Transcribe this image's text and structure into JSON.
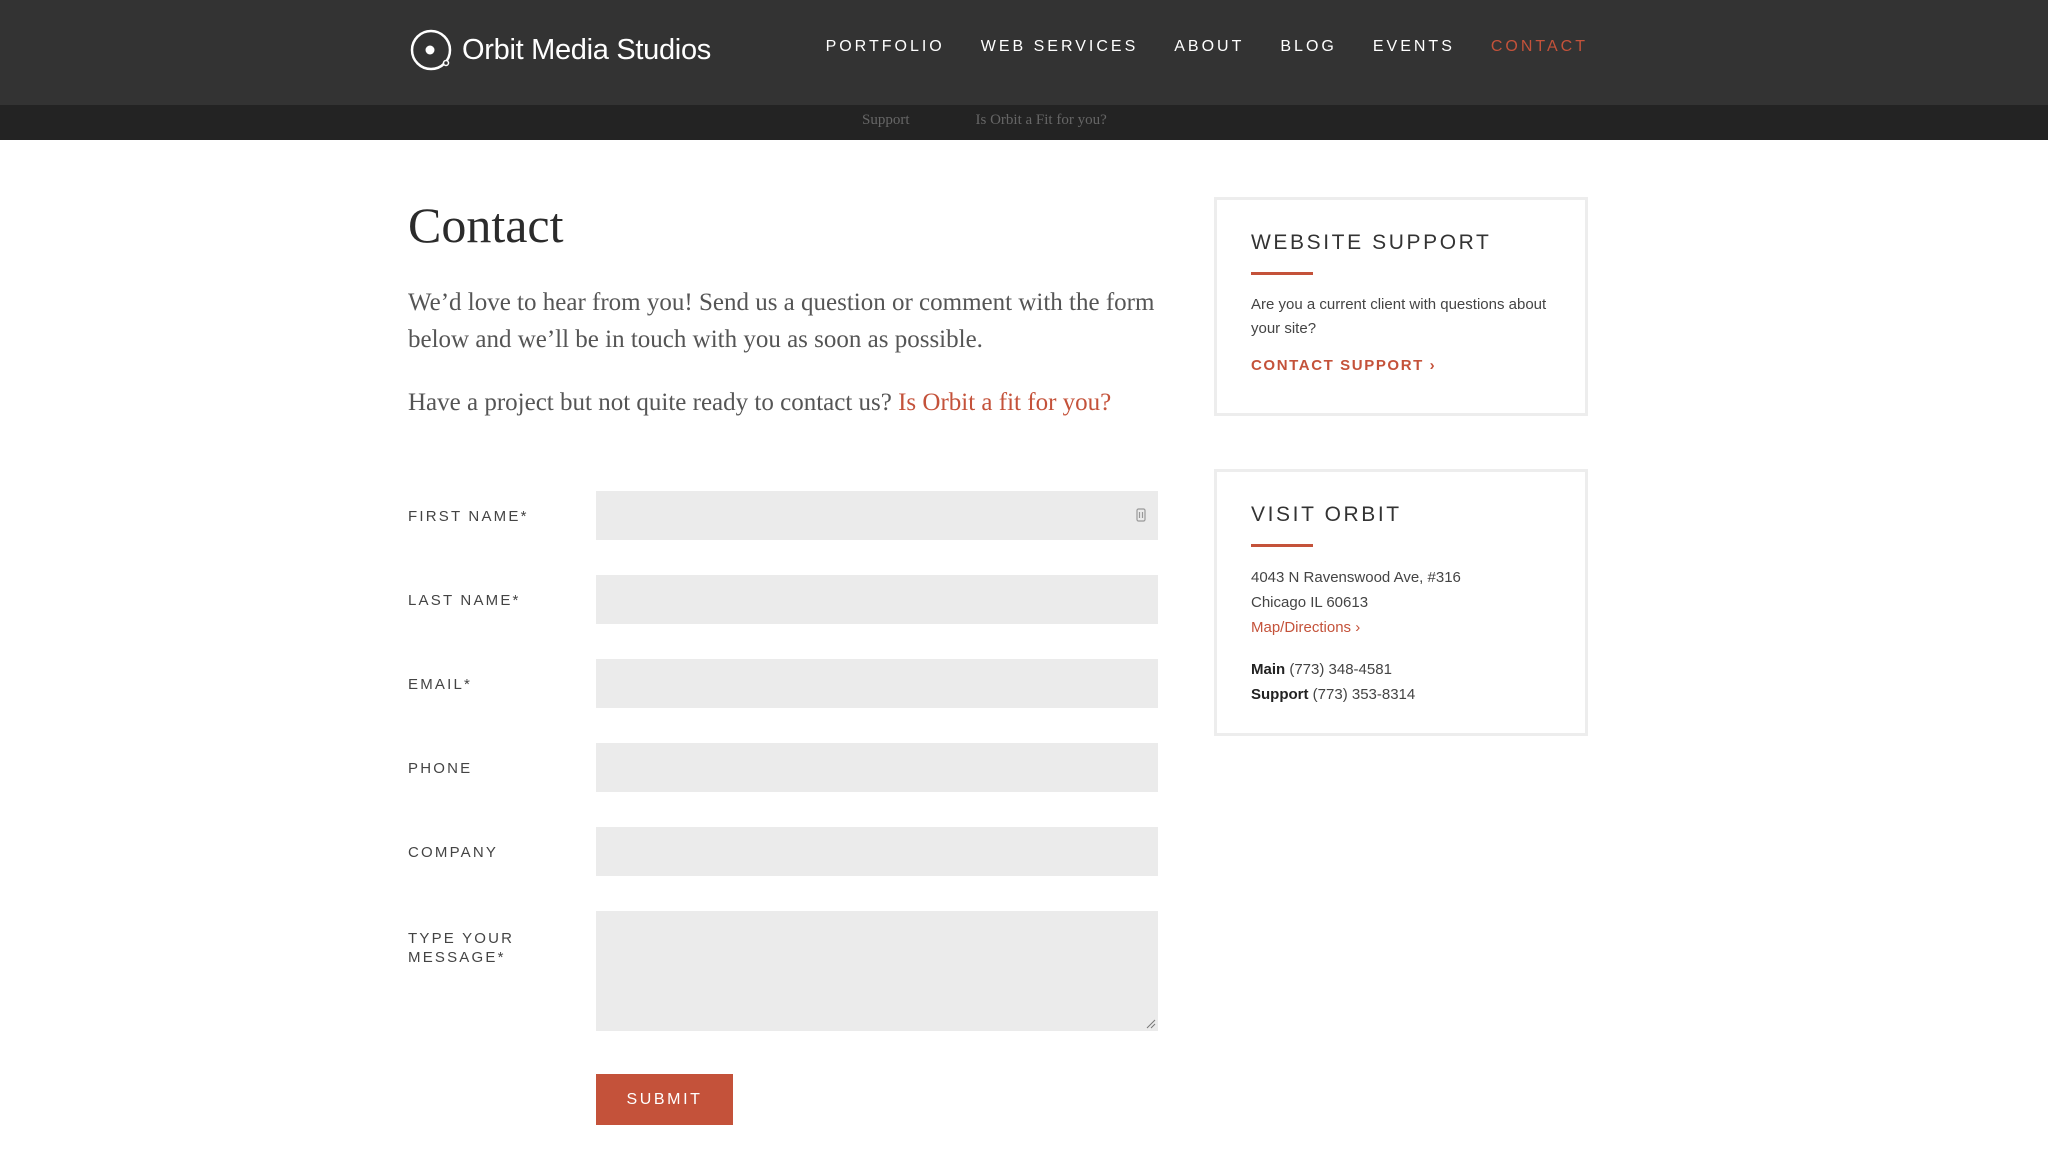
{
  "header": {
    "logo_text": "Orbit Media Studios",
    "nav": [
      {
        "label": "PORTFOLIO"
      },
      {
        "label": "WEB SERVICES"
      },
      {
        "label": "ABOUT"
      },
      {
        "label": "BLOG"
      },
      {
        "label": "EVENTS"
      },
      {
        "label": "CONTACT",
        "active": true
      }
    ],
    "subnav": [
      {
        "label": "Support"
      },
      {
        "label": "Is Orbit a Fit for you?"
      }
    ]
  },
  "main": {
    "title": "Contact",
    "intro": "We’d love to hear from you! Send us a question or comment with the form below and we’ll be in touch with you as soon as possible.",
    "intro2_prefix": "Have a project but not quite ready to contact us? ",
    "intro2_link": "Is Orbit a fit for you?"
  },
  "form": {
    "fields": [
      {
        "label": "FIRST NAME*",
        "value": ""
      },
      {
        "label": "LAST NAME*",
        "value": ""
      },
      {
        "label": "EMAIL*",
        "value": ""
      },
      {
        "label": "PHONE",
        "value": ""
      },
      {
        "label": "COMPANY",
        "value": ""
      }
    ],
    "message_label": "TYPE YOUR MESSAGE*",
    "submit_label": "SUBMIT"
  },
  "sidebar": {
    "support": {
      "title": "WEBSITE SUPPORT",
      "text": "Are you a current client with questions about your site?",
      "link": "CONTACT SUPPORT ›"
    },
    "visit": {
      "title": "VISIT ORBIT",
      "address_line1": "4043 N Ravenswood Ave, #316",
      "address_line2": "Chicago IL 60613",
      "map_link": "Map/Directions ›",
      "main_label": "Main",
      "main_phone": " (773) 348-4581",
      "support_label": "Support",
      "support_phone": " (773) 353-8314"
    }
  },
  "colors": {
    "accent": "#c4523a",
    "header_bg": "#333333",
    "subnav_bg": "#232323",
    "input_bg": "#ebebeb"
  }
}
